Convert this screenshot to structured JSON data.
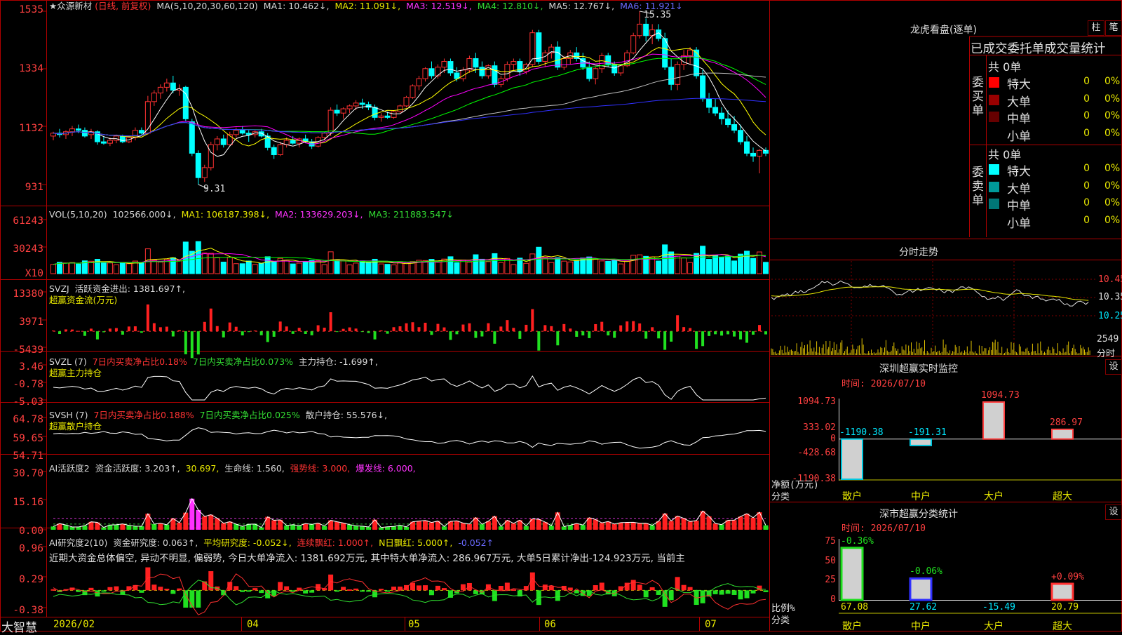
{
  "brand": "大智慧",
  "main_legend": {
    "stock": "★众源新材",
    "mode": "(日线, 前复权)",
    "ma_title": "MA(5,10,20,30,60,120)",
    "ma1": "MA1: 10.462↓,",
    "ma2": "MA2: 11.091↓,",
    "ma3": "MA3: 12.519↓,",
    "ma4": "MA4: 12.810↓,",
    "ma5": "MA5: 12.767↓,",
    "ma6": "MA6: 11.921↓"
  },
  "vol_legend": {
    "title": "VOL(5,10,20)",
    "cur": "102566.000↓,",
    "ma1": "MA1: 106187.398↓,",
    "ma2": "MA2: 133629.203↓,",
    "ma3": "MA3: 211883.547↓"
  },
  "svzj_legend": {
    "title": "SVZJ",
    "l1": "活跃资金进出: 1381.697↑,",
    "l2": "超赢资金流(万元)"
  },
  "svzl_legend": {
    "title": "SVZL (7)",
    "a": "7日内买卖净占比0.18%",
    "b": "7日内买卖净占比0.073%",
    "c": "主力持仓: -1.699↑,",
    "l2": "超赢主力持仓"
  },
  "svsh_legend": {
    "title": "SVSH (7)",
    "a": "7日内买卖净占比0.188%",
    "b": "7日内买卖净占比0.025%",
    "c": "散户持仓: 55.576↓,",
    "l2": "超赢散户持仓"
  },
  "ai1_legend": {
    "title": "AI活跃度2",
    "a": "资金活跃度: 3.203↑,",
    "b": "30.697,",
    "c": "生命线: 1.560,",
    "d": "强势线: 3.000,",
    "e": "爆发线: 6.000,"
  },
  "ai2_legend": {
    "title": "AI研究度2(10)",
    "a": "资金研究度: 0.063↑,",
    "b": "平均研究度: -0.052↓,",
    "c": "连续飘红: 1.000↑,",
    "d": "N日飘红: 5.000↑,",
    "e": "-0.052↑"
  },
  "ai2_summary": "近期大资金总体偏空, 异动不明显, 偏弱势, 今日大单净流入: 1381.692万元, 其中特大单净流入: 286.967万元, 大单5日累计净出-124.923万元, 当前主",
  "yticks": {
    "price": [
      "1535",
      "1334",
      "1132",
      "931"
    ],
    "vol": [
      "61243",
      "30243",
      "X10"
    ],
    "svzj": [
      "13380",
      "3971",
      "-5439"
    ],
    "svzl": [
      "3.46",
      "-0.78",
      "-5.03"
    ],
    "svsh": [
      "64.78",
      "59.65",
      "54.71"
    ],
    "ai1": [
      "30.70",
      "15.16",
      "0.00"
    ],
    "ai2": [
      "0.96",
      "0.29",
      "-0.38"
    ]
  },
  "xticks": [
    "2026/02",
    "04",
    "05",
    "06",
    "07"
  ],
  "annotations": {
    "high": "15.35",
    "low": "9.31"
  },
  "right": {
    "longhu_title": "龙虎看盘(逐单)",
    "btn_zhu": "柱",
    "btn_bi": "笔",
    "stats_title": "已成交委托单成交量统计",
    "buy_side": "委买单",
    "sell_side": "委卖单",
    "buy_total": "共 0单",
    "sell_total": "共 0单",
    "buy_rows": [
      {
        "label": "特大",
        "value": "0",
        "pct": "0%",
        "color": "#ff0000"
      },
      {
        "label": "大单",
        "value": "0",
        "pct": "0%",
        "color": "#990000"
      },
      {
        "label": "中单",
        "value": "0",
        "pct": "0%",
        "color": "#660000"
      },
      {
        "label": "小单",
        "value": "0",
        "pct": "0%",
        "color": "#000000"
      }
    ],
    "sell_rows": [
      {
        "label": "特大",
        "value": "0",
        "pct": "0%",
        "color": "#00ffff"
      },
      {
        "label": "大单",
        "value": "0",
        "pct": "0%",
        "color": "#009999"
      },
      {
        "label": "中单",
        "value": "0",
        "pct": "0%",
        "color": "#007777"
      },
      {
        "label": "小单",
        "value": "0",
        "pct": "0%",
        "color": "#000000"
      }
    ],
    "intraday_title": "分时走势",
    "intraday_ticks": [
      "10.45",
      "10.35",
      "10.25"
    ],
    "intraday_vol_label": "2549",
    "intraday_vol_unit": "分时",
    "monitor_title": "深圳超赢实时监控",
    "monitor_time": "时间: 2026/07/10",
    "monitor_btn": "设",
    "monitor_yticks": [
      "1094.73",
      "333.02",
      "0",
      "-428.68",
      "-1190.38"
    ],
    "monitor_ylabel1": "净额(万元)",
    "monitor_ylabel2": "分类",
    "monitor_cats": [
      "散户",
      "中户",
      "大户",
      "超大"
    ],
    "monitor_values": [
      "-1190.38",
      "-191.31",
      "1094.73",
      "286.97"
    ],
    "class_title": "深市超赢分类统计",
    "class_time": "时间: 2026/07/10",
    "class_btn": "设",
    "class_yticks": [
      "75",
      "50",
      "25",
      "0"
    ],
    "class_ylabel1": "比例%",
    "class_ylabel2": "分类",
    "class_cats": [
      "散户",
      "中户",
      "大户",
      "超大"
    ],
    "class_top_labels": [
      "-0.36%",
      "-0.06%",
      "",
      "+0.09%"
    ],
    "class_bottom_values": [
      "67.08",
      "27.62",
      "-15.49",
      "20.79"
    ]
  },
  "colors": {
    "up": "#ff3232",
    "down": "#00ffff",
    "ma1": "#ffffff",
    "ma2": "#ffff00",
    "ma3": "#ff00ff",
    "ma4": "#00ff00",
    "ma5": "#c0c0c0",
    "ma6": "#3030ff",
    "frame": "#b00000"
  },
  "chart_data": [
    {
      "type": "candlestick",
      "title": "众源新材 日线 前复权",
      "ylim": [
        9.31,
        15.35
      ],
      "yticks": [
        15.35,
        13.34,
        11.32,
        9.31
      ],
      "ohlc": [
        [
          11.0,
          11.15,
          10.85,
          11.1
        ],
        [
          11.1,
          11.25,
          10.95,
          11.05
        ],
        [
          11.05,
          11.2,
          10.9,
          11.15
        ],
        [
          11.15,
          11.35,
          11.0,
          11.25
        ],
        [
          11.25,
          11.4,
          11.1,
          11.2
        ],
        [
          11.2,
          11.3,
          10.95,
          11.0
        ],
        [
          11.05,
          11.25,
          10.9,
          11.15
        ],
        [
          11.15,
          11.2,
          10.7,
          10.8
        ],
        [
          10.8,
          11.0,
          10.7,
          10.75
        ],
        [
          10.75,
          10.95,
          10.65,
          10.85
        ],
        [
          10.85,
          11.05,
          10.75,
          11.0
        ],
        [
          11.0,
          11.05,
          10.75,
          10.8
        ],
        [
          10.8,
          11.0,
          10.75,
          10.95
        ],
        [
          10.95,
          11.3,
          10.85,
          11.2
        ],
        [
          11.2,
          11.3,
          11.05,
          11.1
        ],
        [
          11.1,
          12.4,
          11.05,
          12.2
        ],
        [
          12.2,
          12.6,
          12.05,
          12.5
        ],
        [
          12.5,
          12.8,
          12.3,
          12.7
        ],
        [
          12.7,
          13.0,
          12.55,
          12.85
        ],
        [
          12.85,
          13.1,
          12.5,
          12.6
        ],
        [
          12.6,
          12.8,
          12.4,
          12.65
        ],
        [
          12.7,
          12.75,
          11.5,
          11.6
        ],
        [
          11.5,
          11.6,
          10.3,
          10.4
        ],
        [
          10.4,
          10.5,
          9.31,
          9.55
        ],
        [
          9.55,
          10.0,
          9.4,
          9.9
        ],
        [
          9.9,
          10.8,
          9.8,
          10.7
        ],
        [
          10.7,
          11.0,
          10.5,
          10.9
        ],
        [
          10.9,
          11.05,
          10.6,
          10.7
        ],
        [
          10.7,
          11.15,
          10.65,
          11.05
        ],
        [
          11.05,
          11.3,
          10.95,
          11.2
        ],
        [
          11.2,
          11.35,
          11.05,
          11.1
        ],
        [
          11.1,
          11.2,
          10.8,
          11.05
        ],
        [
          11.05,
          11.2,
          10.95,
          11.15
        ],
        [
          11.15,
          11.25,
          10.95,
          11.0
        ],
        [
          11.0,
          11.1,
          10.5,
          10.6
        ],
        [
          10.6,
          10.7,
          10.2,
          10.35
        ],
        [
          10.35,
          10.8,
          10.3,
          10.7
        ],
        [
          10.7,
          10.95,
          10.6,
          10.85
        ],
        [
          10.85,
          11.0,
          10.7,
          10.75
        ],
        [
          10.75,
          10.95,
          10.6,
          10.9
        ],
        [
          10.9,
          11.05,
          10.75,
          10.8
        ],
        [
          10.8,
          10.9,
          10.55,
          10.65
        ],
        [
          10.65,
          11.0,
          10.6,
          10.95
        ],
        [
          10.95,
          11.15,
          10.85,
          11.1
        ],
        [
          11.1,
          12.0,
          11.0,
          11.9
        ],
        [
          11.9,
          12.1,
          11.7,
          11.8
        ],
        [
          11.8,
          12.0,
          11.6,
          11.95
        ],
        [
          11.95,
          12.1,
          11.8,
          12.05
        ],
        [
          12.05,
          12.25,
          11.9,
          12.15
        ],
        [
          12.15,
          12.3,
          11.95,
          12.1
        ],
        [
          12.1,
          12.2,
          11.9,
          12.0
        ],
        [
          12.0,
          12.1,
          11.55,
          11.65
        ],
        [
          11.65,
          11.8,
          11.5,
          11.7
        ],
        [
          11.7,
          11.85,
          11.6,
          11.65
        ],
        [
          11.65,
          11.9,
          11.6,
          11.85
        ],
        [
          11.85,
          12.1,
          11.8,
          12.05
        ],
        [
          12.05,
          12.4,
          12.0,
          12.35
        ],
        [
          12.35,
          12.8,
          12.3,
          12.75
        ],
        [
          12.75,
          13.1,
          12.6,
          13.0
        ],
        [
          13.0,
          13.4,
          12.9,
          13.35
        ],
        [
          13.35,
          13.6,
          13.0,
          13.1
        ],
        [
          13.1,
          13.5,
          13.0,
          13.4
        ],
        [
          13.4,
          13.7,
          13.2,
          13.6
        ],
        [
          13.6,
          13.7,
          13.1,
          13.2
        ],
        [
          13.2,
          13.4,
          12.9,
          13.0
        ],
        [
          13.0,
          13.4,
          12.9,
          13.3
        ],
        [
          13.3,
          13.8,
          13.2,
          13.7
        ],
        [
          13.7,
          13.9,
          13.2,
          13.4
        ],
        [
          13.4,
          13.6,
          13.0,
          13.1
        ],
        [
          13.1,
          13.5,
          13.0,
          13.45
        ],
        [
          13.45,
          13.6,
          12.7,
          12.8
        ],
        [
          12.8,
          13.1,
          12.7,
          13.0
        ],
        [
          13.0,
          13.6,
          12.9,
          13.5
        ],
        [
          13.5,
          13.7,
          13.3,
          13.6
        ],
        [
          13.6,
          13.7,
          13.1,
          13.25
        ],
        [
          13.25,
          13.55,
          13.15,
          13.5
        ],
        [
          13.5,
          14.7,
          13.4,
          14.6
        ],
        [
          14.6,
          14.7,
          13.5,
          13.6
        ],
        [
          13.6,
          14.0,
          13.4,
          13.9
        ],
        [
          13.9,
          14.2,
          13.7,
          14.1
        ],
        [
          14.1,
          14.3,
          13.3,
          13.4
        ],
        [
          13.4,
          13.8,
          13.3,
          13.7
        ],
        [
          13.7,
          14.0,
          13.5,
          13.9
        ],
        [
          13.9,
          14.1,
          13.6,
          13.7
        ],
        [
          13.7,
          13.9,
          13.3,
          13.4
        ],
        [
          13.4,
          13.6,
          12.9,
          13.0
        ],
        [
          13.0,
          13.4,
          12.8,
          13.35
        ],
        [
          13.35,
          13.9,
          13.2,
          13.8
        ],
        [
          13.8,
          13.9,
          13.4,
          13.5
        ],
        [
          13.5,
          13.6,
          13.1,
          13.2
        ],
        [
          13.2,
          13.5,
          13.1,
          13.45
        ],
        [
          13.45,
          14.0,
          13.4,
          13.9
        ],
        [
          13.9,
          14.6,
          13.85,
          14.5
        ],
        [
          14.5,
          15.35,
          14.4,
          14.9
        ],
        [
          14.9,
          15.1,
          14.3,
          14.5
        ],
        [
          14.5,
          14.9,
          14.2,
          14.7
        ],
        [
          14.7,
          14.9,
          14.3,
          14.4
        ],
        [
          14.4,
          14.6,
          13.3,
          13.4
        ],
        [
          13.4,
          13.7,
          12.6,
          12.8
        ],
        [
          12.8,
          13.6,
          12.6,
          13.5
        ],
        [
          13.5,
          14.0,
          13.3,
          13.8
        ],
        [
          13.8,
          14.1,
          13.5,
          14.0
        ],
        [
          14.0,
          14.1,
          13.0,
          13.1
        ],
        [
          13.1,
          13.3,
          12.2,
          12.3
        ],
        [
          12.3,
          12.5,
          11.8,
          12.0
        ],
        [
          12.0,
          12.3,
          11.7,
          11.8
        ],
        [
          11.8,
          12.0,
          11.4,
          11.6
        ],
        [
          11.6,
          11.9,
          11.3,
          11.4
        ],
        [
          11.4,
          11.7,
          11.1,
          11.2
        ],
        [
          11.2,
          11.4,
          10.7,
          10.8
        ],
        [
          10.8,
          11.0,
          10.3,
          10.4
        ],
        [
          10.4,
          10.6,
          10.1,
          10.3
        ],
        [
          10.3,
          10.55,
          9.7,
          10.5
        ],
        [
          10.5,
          10.6,
          10.3,
          10.4
        ]
      ]
    },
    {
      "type": "bar",
      "title": "VOL",
      "ylim": [
        0,
        70000
      ],
      "note": "bar heights follow daily volume"
    },
    {
      "type": "bar",
      "title": "SVZJ",
      "ylim": [
        -5439,
        13380
      ]
    },
    {
      "type": "line",
      "title": "SVZL",
      "ylim": [
        -5.03,
        3.46
      ]
    },
    {
      "type": "line",
      "title": "SVSH",
      "ylim": [
        54.71,
        64.78
      ]
    },
    {
      "type": "bar",
      "title": "AI活跃度2",
      "ylim": [
        0,
        30.7
      ]
    },
    {
      "type": "line",
      "title": "AI研究度2",
      "ylim": [
        -0.38,
        0.96
      ]
    },
    {
      "type": "bar",
      "title": "深圳超赢实时监控",
      "categories": [
        "散户",
        "中户",
        "大户",
        "超大"
      ],
      "values": [
        -1190.38,
        -191.31,
        1094.73,
        286.97
      ],
      "ylim": [
        -1190.38,
        1094.73
      ]
    },
    {
      "type": "bar",
      "title": "深市超赢分类统计",
      "categories": [
        "散户",
        "中户",
        "大户",
        "超大"
      ],
      "values": [
        67.08,
        27.62,
        -15.49,
        20.79
      ],
      "ylim": [
        0,
        75
      ]
    }
  ]
}
